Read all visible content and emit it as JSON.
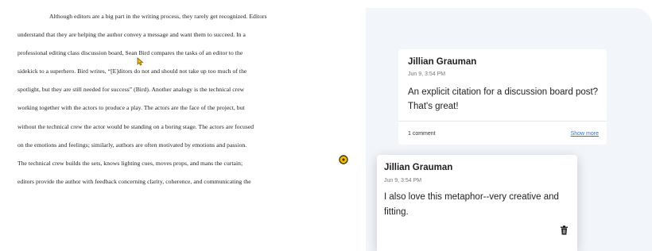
{
  "document": {
    "lines": [
      "Although editors are a big part in the writing process, they rarely get recognized. Editors",
      "understand that they are helping the author convey a message and want them to succeed. In a",
      "professional editing class discussion board, Sean Bird compares the tasks of an editor to the",
      "sidekick to a superhero. Bird writes, “[E]ditors do not and should not take up too much of the",
      "spotlight, but they are still needed for success” (Bird). Another analogy is the technical crew",
      "working together with the actors to produce a play. The actors are the face of the project, but",
      "without the technical crew the actor would be standing on a boring stage. The actors are focused",
      "on the emotions and feelings; similarly, authors are often motivated by emotions and passion.",
      "The technical crew builds the sets, knows lighting cues, moves props, and mans the curtain;",
      "editors provide the author with feedback concerning clarity, coherence, and communicating the"
    ],
    "cursor_icon": "comment-cursor-icon",
    "accent_color": "#e0b000"
  },
  "panel": {
    "background": "#f2f5f9"
  },
  "comment1": {
    "author": "Jillian Grauman",
    "time": "Jun 9, 3:54 PM",
    "text": "An explicit citation for a discussion board post? That's great!",
    "reply_count": "1 comment",
    "show_more": "Show more"
  },
  "comment2": {
    "author": "Jillian Grauman",
    "time": "Jun 9, 3:54 PM",
    "text": "I also love this metaphor--very creative and fitting.",
    "delete_icon": "trash-icon"
  }
}
